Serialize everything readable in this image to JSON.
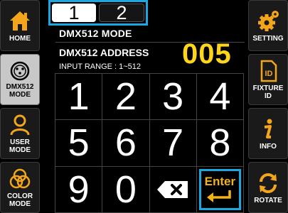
{
  "sidebar_left": {
    "items": [
      {
        "label": "HOME",
        "icon": "home-icon",
        "active": false
      },
      {
        "label": "DMX512\nMODE",
        "icon": "dmx-connector-icon",
        "active": true
      },
      {
        "label": "USER\nMODE",
        "icon": "user-icon",
        "active": false
      },
      {
        "label": "COLOR\nMODE",
        "icon": "color-circles-icon",
        "active": false
      }
    ]
  },
  "sidebar_right": {
    "items": [
      {
        "label": "SETTING",
        "icon": "gear-icon"
      },
      {
        "label": "FIXTURE\nID",
        "icon": "id-card-icon"
      },
      {
        "label": "INFO",
        "icon": "info-icon"
      },
      {
        "label": "ROTATE",
        "icon": "rotate-icon"
      }
    ]
  },
  "pages": {
    "tab1": "1",
    "tab2": "2",
    "active": "1"
  },
  "main": {
    "mode_title": "DMX512 MODE",
    "address_label": "DMX512 ADDRESS",
    "address_value": "005",
    "input_range": "INPUT RANGE : 1~512"
  },
  "keypad": {
    "keys": [
      "1",
      "2",
      "3",
      "4",
      "5",
      "6",
      "7",
      "8",
      "9",
      "0"
    ],
    "backspace_icon": "backspace-icon",
    "enter_label": "Enter"
  },
  "colors": {
    "accent_blue": "#1ca7e0",
    "address_yellow": "#ffd51a",
    "enter_orange": "#f3b21b",
    "icon_orange": "#f3a51b"
  }
}
